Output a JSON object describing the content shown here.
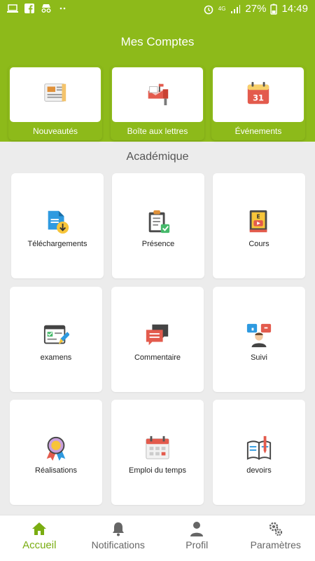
{
  "statusbar": {
    "battery": "27%",
    "time": "14:49",
    "network": "4G"
  },
  "header": {
    "title": "Mes Comptes",
    "cards": [
      {
        "label": "Nouveautés",
        "icon": "newspaper-icon"
      },
      {
        "label": "Boîte aux lettres",
        "icon": "mailbox-icon"
      },
      {
        "label": "Événements",
        "icon": "calendar-31-icon"
      }
    ]
  },
  "section": {
    "title": "Académique"
  },
  "tiles": [
    {
      "label": "Téléchargements",
      "icon": "download-document-icon"
    },
    {
      "label": "Présence",
      "icon": "clipboard-check-icon"
    },
    {
      "label": "Cours",
      "icon": "book-video-icon"
    },
    {
      "label": "examens",
      "icon": "exam-pencil-icon"
    },
    {
      "label": "Commentaire",
      "icon": "comment-bubbles-icon"
    },
    {
      "label": "Suivi",
      "icon": "tracking-icon"
    },
    {
      "label": "Réalisations",
      "icon": "award-ribbon-icon"
    },
    {
      "label": "Emploi du temps",
      "icon": "schedule-calendar-icon"
    },
    {
      "label": "devoirs",
      "icon": "homework-book-icon"
    }
  ],
  "nav": [
    {
      "label": "Accueil",
      "icon": "home-icon",
      "active": true
    },
    {
      "label": "Notifications",
      "icon": "bell-icon"
    },
    {
      "label": "Profil",
      "icon": "person-icon"
    },
    {
      "label": "Paramètres",
      "icon": "gears-icon"
    }
  ],
  "colors": {
    "brand": "#8dba1a",
    "active_nav": "#7aad12",
    "background": "#ececec"
  }
}
